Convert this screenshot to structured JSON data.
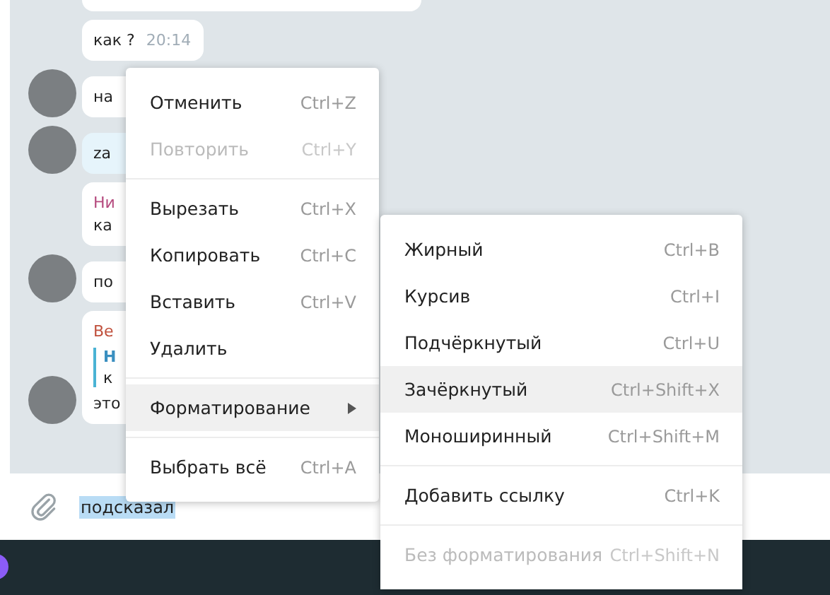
{
  "chat": {
    "messages": [
      {
        "kind": "cut-off",
        "avatar": false,
        "highlighted": false
      },
      {
        "kind": "text",
        "avatar": false,
        "highlighted": false,
        "text": "как ?",
        "time": "20:14"
      },
      {
        "kind": "text",
        "avatar": true,
        "highlighted": false,
        "text": "на"
      },
      {
        "kind": "text",
        "avatar": true,
        "highlighted": true,
        "text": "za"
      },
      {
        "kind": "named",
        "avatar": false,
        "highlighted": false,
        "sender": "Ни",
        "color": "#b54a7e",
        "text": "ка"
      },
      {
        "kind": "text",
        "avatar": true,
        "highlighted": false,
        "text": "по"
      },
      {
        "kind": "reply",
        "avatar": true,
        "highlighted": false,
        "sender": "Ве",
        "color": "#c0503c",
        "quote_title": "Н",
        "quote_text": "к",
        "text": "это"
      }
    ]
  },
  "composer": {
    "value": "подсказал"
  },
  "edit_menu": {
    "items": [
      {
        "kind": "item",
        "label": "Отменить",
        "shortcut": "Ctrl+Z",
        "disabled": false,
        "selected": false,
        "submenu": false
      },
      {
        "kind": "item",
        "label": "Повторить",
        "shortcut": "Ctrl+Y",
        "disabled": true,
        "selected": false,
        "submenu": false
      },
      {
        "kind": "separator"
      },
      {
        "kind": "item",
        "label": "Вырезать",
        "shortcut": "Ctrl+X",
        "disabled": false,
        "selected": false,
        "submenu": false
      },
      {
        "kind": "item",
        "label": "Копировать",
        "shortcut": "Ctrl+C",
        "disabled": false,
        "selected": false,
        "submenu": false
      },
      {
        "kind": "item",
        "label": "Вставить",
        "shortcut": "Ctrl+V",
        "disabled": false,
        "selected": false,
        "submenu": false
      },
      {
        "kind": "item",
        "label": "Удалить",
        "disabled": false,
        "selected": false,
        "submenu": false
      },
      {
        "kind": "separator"
      },
      {
        "kind": "item",
        "label": "Форматирование",
        "disabled": false,
        "selected": true,
        "submenu": true
      },
      {
        "kind": "separator"
      },
      {
        "kind": "item",
        "label": "Выбрать всё",
        "shortcut": "Ctrl+A",
        "disabled": false,
        "selected": false,
        "submenu": false
      }
    ]
  },
  "format_menu": {
    "items": [
      {
        "kind": "item",
        "label": "Жирный",
        "shortcut": "Ctrl+B",
        "disabled": false,
        "selected": false,
        "submenu": false
      },
      {
        "kind": "item",
        "label": "Курсив",
        "shortcut": "Ctrl+I",
        "disabled": false,
        "selected": false,
        "submenu": false
      },
      {
        "kind": "item",
        "label": "Подчёркнутый",
        "shortcut": "Ctrl+U",
        "disabled": false,
        "selected": false,
        "submenu": false
      },
      {
        "kind": "item",
        "label": "Зачёркнутый",
        "shortcut": "Ctrl+Shift+X",
        "disabled": false,
        "selected": true,
        "submenu": false
      },
      {
        "kind": "item",
        "label": "Моноширинный",
        "shortcut": "Ctrl+Shift+M",
        "disabled": false,
        "selected": false,
        "submenu": false
      },
      {
        "kind": "separator"
      },
      {
        "kind": "item",
        "label": "Добавить ссылку",
        "shortcut": "Ctrl+K",
        "disabled": false,
        "selected": false,
        "submenu": false
      },
      {
        "kind": "separator"
      },
      {
        "kind": "item",
        "label": "Без форматирования",
        "shortcut": "Ctrl+Shift+N",
        "disabled": true,
        "selected": false,
        "submenu": false
      }
    ]
  }
}
